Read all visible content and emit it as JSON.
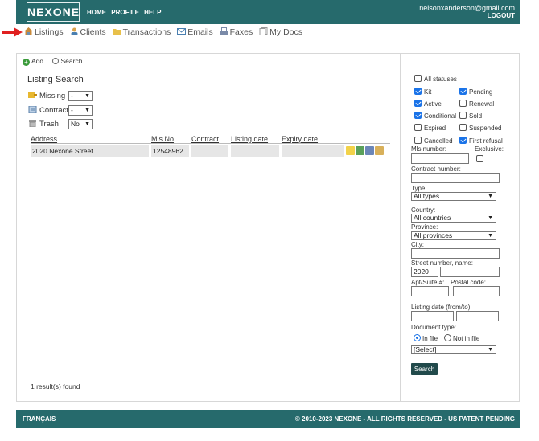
{
  "header": {
    "logo": "NEXONE",
    "nav": [
      "HOME",
      "PROFILE",
      "HELP"
    ],
    "user_email": "nelsonxanderson@gmail.com",
    "logout": "LOGOUT"
  },
  "secondary_nav": {
    "items": [
      {
        "label": "Listings",
        "icon": "house-icon"
      },
      {
        "label": "Clients",
        "icon": "person-icon"
      },
      {
        "label": "Transactions",
        "icon": "folder-icon"
      },
      {
        "label": "Emails",
        "icon": "envelope-icon"
      },
      {
        "label": "Faxes",
        "icon": "fax-icon"
      },
      {
        "label": "My Docs",
        "icon": "documents-icon"
      }
    ]
  },
  "actions": {
    "add": "Add",
    "search": "Search"
  },
  "listing_search": {
    "title": "Listing Search",
    "filters": {
      "missing": {
        "label": "Missing",
        "value": "-"
      },
      "contract": {
        "label": "Contract",
        "value": "-"
      },
      "trash": {
        "label": "Trash",
        "value": "No"
      }
    },
    "columns": [
      "Address",
      "Mls No",
      "Contract",
      "Listing date",
      "Expiry date"
    ],
    "rows": [
      {
        "address": "2020 Nexone Street",
        "mls": "12548962",
        "contract": "",
        "listing_date": "",
        "expiry_date": ""
      }
    ],
    "result_text": "1 result(s) found"
  },
  "search_panel": {
    "all_statuses": "All statuses",
    "statuses": [
      {
        "label": "Kit",
        "checked": true
      },
      {
        "label": "Pending",
        "checked": true
      },
      {
        "label": "Active",
        "checked": true
      },
      {
        "label": "Renewal",
        "checked": false
      },
      {
        "label": "Conditional",
        "checked": true
      },
      {
        "label": "Sold",
        "checked": false
      },
      {
        "label": "Expired",
        "checked": false
      },
      {
        "label": "Suspended",
        "checked": false
      },
      {
        "label": "Cancelled",
        "checked": false
      },
      {
        "label": "First refusal",
        "checked": true
      }
    ],
    "mls_number_label": "Mls number:",
    "exclusive_label": "Exclusive:",
    "contract_number_label": "Contract number:",
    "type_label": "Type:",
    "type_value": "All types",
    "country_label": "Country:",
    "country_value": "All countries",
    "province_label": "Province:",
    "province_value": "All provinces",
    "city_label": "City:",
    "street_label": "Street number, name:",
    "street_number": "2020",
    "apt_label": "Apt/Suite #:",
    "postal_label": "Postal code:",
    "listing_date_label": "Listing date (from/to):",
    "doc_type_label": "Document type:",
    "in_file": "In file",
    "not_in_file": "Not in file",
    "doc_select_value": "[Select]",
    "search_button": "Search"
  },
  "footer": {
    "language": "FRANÇAIS",
    "copyright": "© 2010-2023 NEXONE - ALL RIGHTS RESERVED - US PATENT PENDING"
  }
}
